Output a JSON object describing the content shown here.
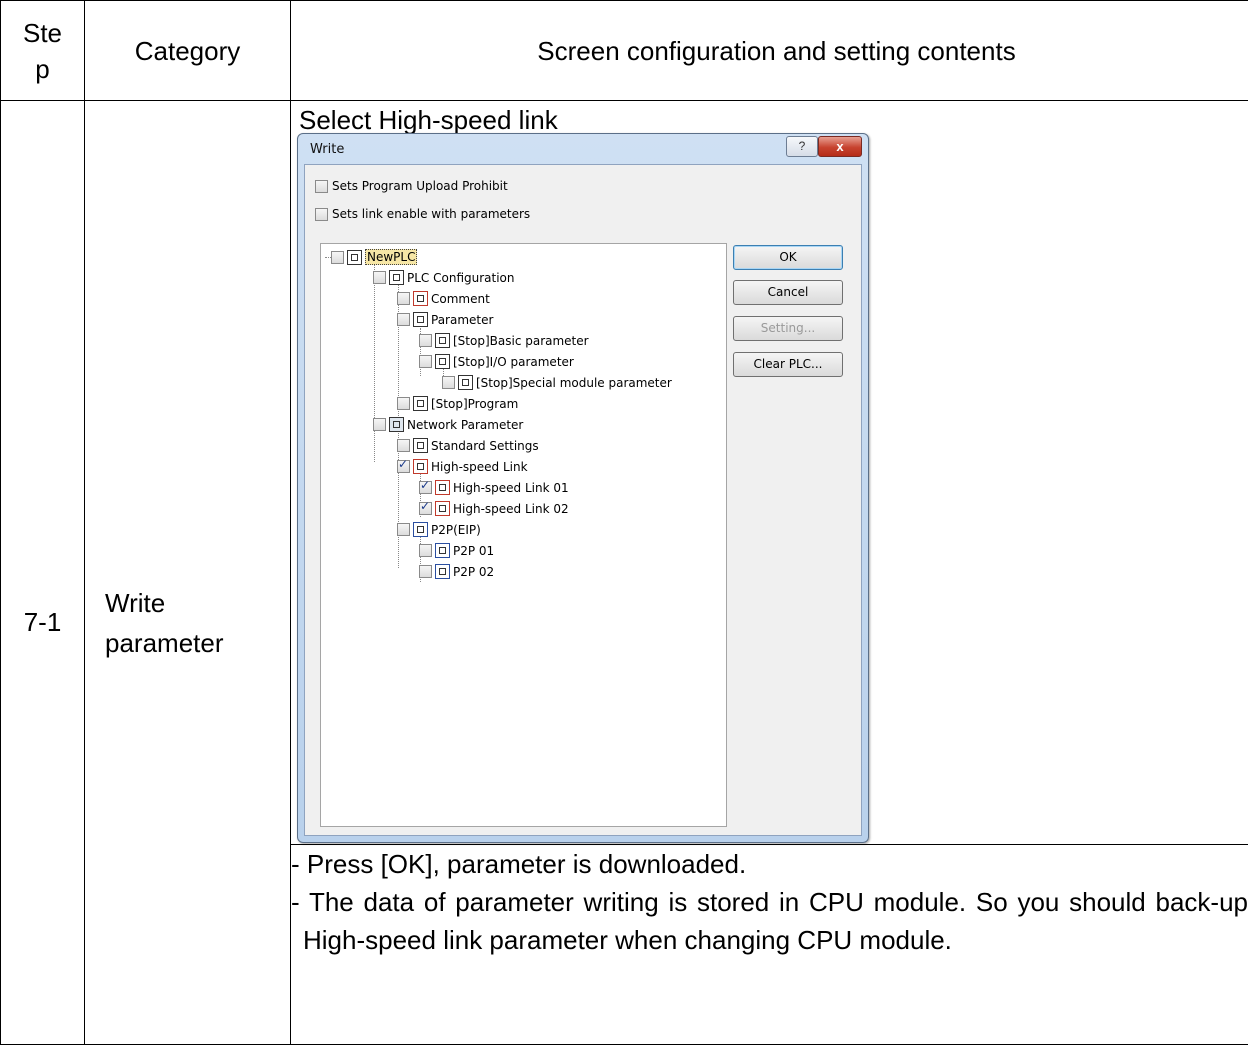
{
  "header_partial": "[ ] [ ]",
  "table": {
    "headers": [
      "Ste\np",
      "Category",
      "Screen configuration and setting contents"
    ],
    "row": {
      "step": "7-1",
      "category": "Write parameter",
      "section_title": "Select High-speed link",
      "notes": [
        "- Press [OK], parameter is downloaded.",
        "- The data of parameter writing is stored in CPU module. So you should back-up High-speed link parameter when changing CPU module."
      ]
    }
  },
  "dialog": {
    "title": "Write",
    "help_label": "?",
    "close_label": "x",
    "options": [
      {
        "label": "Sets Program Upload Prohibit",
        "checked": false
      },
      {
        "label": "Sets link enable with parameters",
        "checked": false
      }
    ],
    "tree": [
      {
        "label": "NewPLC",
        "checked": false
      },
      {
        "label": "PLC Configuration",
        "checked": false
      },
      {
        "label": "Comment",
        "checked": false
      },
      {
        "label": "Parameter",
        "checked": false
      },
      {
        "label": "[Stop]Basic parameter",
        "checked": false
      },
      {
        "label": "[Stop]I/O parameter",
        "checked": false
      },
      {
        "label": "[Stop]Special module parameter",
        "checked": false
      },
      {
        "label": "[Stop]Program",
        "checked": false
      },
      {
        "label": "Network Parameter",
        "checked": false
      },
      {
        "label": "Standard Settings",
        "checked": false
      },
      {
        "label": "High-speed Link",
        "checked": true
      },
      {
        "label": "High-speed Link 01",
        "checked": true
      },
      {
        "label": "High-speed Link 02",
        "checked": true
      },
      {
        "label": "P2P(EIP)",
        "checked": false
      },
      {
        "label": "P2P 01",
        "checked": false
      },
      {
        "label": "P2P 02",
        "checked": false
      }
    ],
    "buttons": {
      "ok": "OK",
      "cancel": "Cancel",
      "setting": "Setting...",
      "clear_plc": "Clear PLC..."
    }
  }
}
